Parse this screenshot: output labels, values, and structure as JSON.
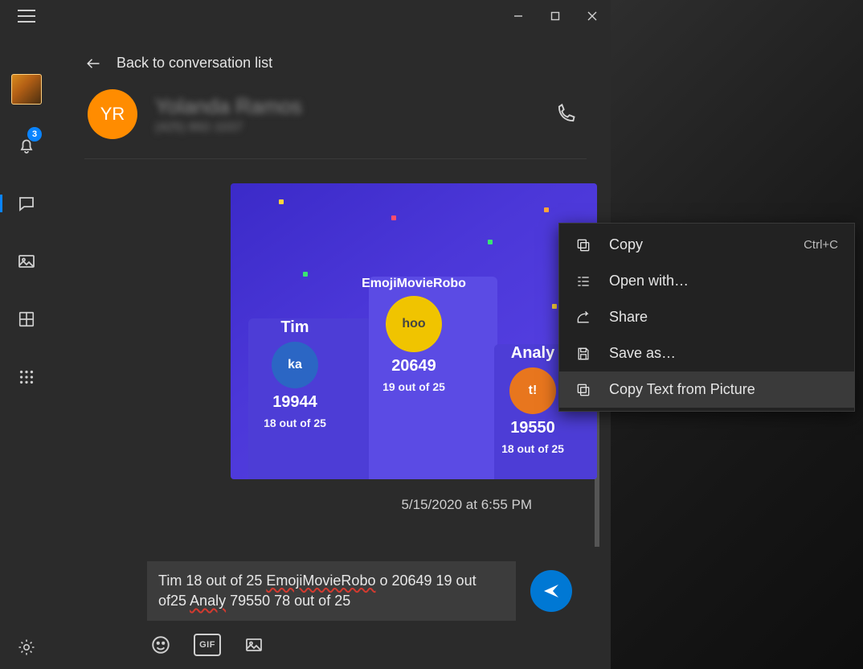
{
  "titlebar": {
    "min": "minimize",
    "max": "maximize",
    "close": "close"
  },
  "sidebar": {
    "notification_badge": "3"
  },
  "header": {
    "back_label": "Back to conversation list",
    "contact_initials": "YR",
    "contact_name": "Yolanda Ramos",
    "contact_phone": "(425) 892-1037"
  },
  "message": {
    "podium": {
      "left": {
        "name": "Tim",
        "medal": "ka",
        "score": "19944",
        "sub": "18 out of 25"
      },
      "mid": {
        "name": "EmojiMovieRobo",
        "medal": "hoo",
        "score": "20649",
        "sub": "19 out of 25"
      },
      "right": {
        "name": "Analy",
        "medal": "t!",
        "score": "19550",
        "sub": "18 out of 25"
      }
    },
    "timestamp": "5/15/2020 at 6:55 PM"
  },
  "compose": {
    "text_pre": "Tim 18 out of 25 ",
    "text_sq1": "EmojiMovieRobo",
    "text_mid": " o 20649 19 out of25 ",
    "text_sq2": "Analy",
    "text_post": " 79550 78 out of 25"
  },
  "attach": {
    "gif": "GIF"
  },
  "context_menu": {
    "items": [
      {
        "label": "Copy",
        "accel": "Ctrl+C"
      },
      {
        "label": "Open with…",
        "accel": ""
      },
      {
        "label": "Share",
        "accel": ""
      },
      {
        "label": "Save as…",
        "accel": ""
      },
      {
        "label": "Copy Text from Picture",
        "accel": ""
      }
    ]
  }
}
